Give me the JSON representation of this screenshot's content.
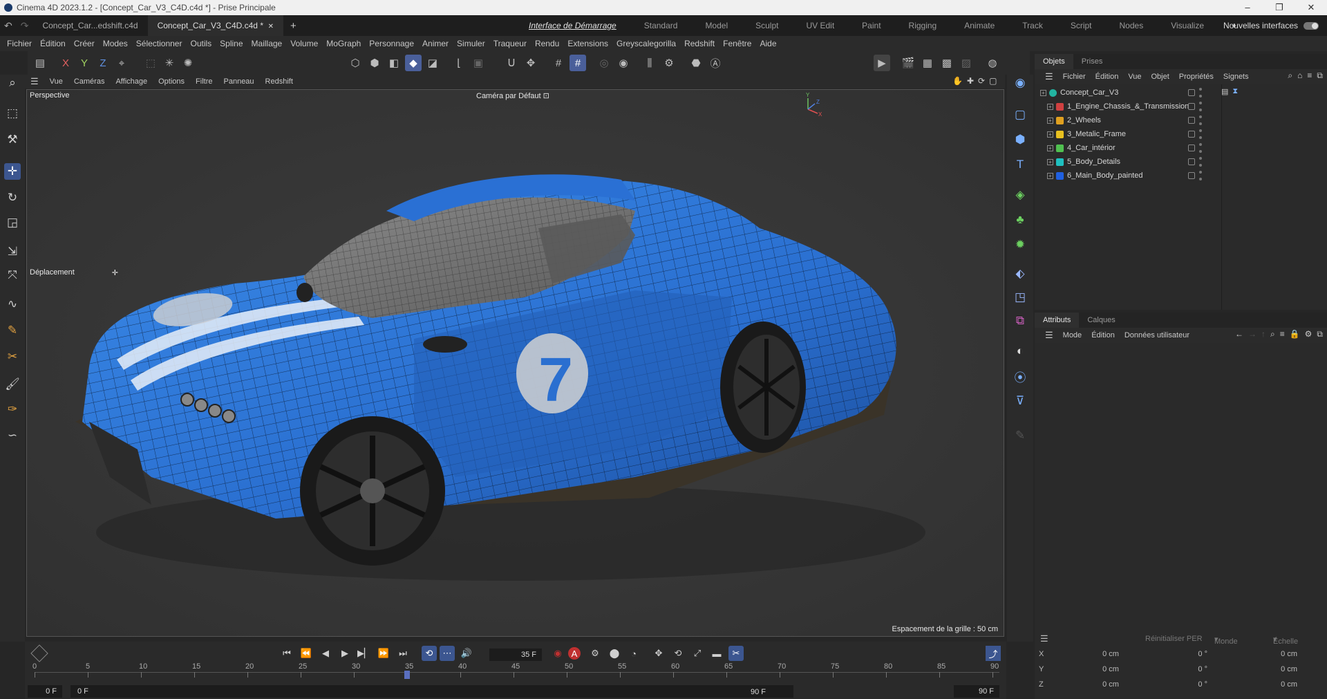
{
  "window": {
    "title": "Cinema 4D 2023.1.2 - [Concept_Car_V3_C4D.c4d *] - Prise Principale",
    "minimize": "–",
    "maximize": "❐",
    "close": "✕"
  },
  "tabs": {
    "doc1": "Concept_Car...edshift.c4d",
    "doc2": "Concept_Car_V3_C4D.c4d *",
    "close": "✕",
    "add": "+"
  },
  "layouts": [
    "Interface de Démarrage",
    "Standard",
    "Model",
    "Sculpt",
    "UV Edit",
    "Paint",
    "Rigging",
    "Animate",
    "Track",
    "Script",
    "Nodes",
    "Visualize"
  ],
  "layout_add": "+",
  "new_interfaces": "Nouvelles interfaces",
  "menu": [
    "Fichier",
    "Édition",
    "Créer",
    "Modes",
    "Sélectionner",
    "Outils",
    "Spline",
    "Maillage",
    "Volume",
    "MoGraph",
    "Personnage",
    "Animer",
    "Simuler",
    "Traqueur",
    "Rendu",
    "Extensions",
    "Greyscalegorilla",
    "Redshift",
    "Fenêtre",
    "Aide"
  ],
  "axis_toggles": {
    "x": "X",
    "y": "Y",
    "z": "Z"
  },
  "viewport": {
    "menu": [
      "Vue",
      "Caméras",
      "Affichage",
      "Options",
      "Filtre",
      "Panneau",
      "Redshift"
    ],
    "view_name": "Perspective",
    "camera": "Caméra par Défaut",
    "hud_tool": "Déplacement",
    "grid_spacing": "Espacement de la grille : 50 cm",
    "car_number": "7"
  },
  "objects": {
    "tabs": [
      "Objets",
      "Prises"
    ],
    "menu": [
      "Fichier",
      "Édition",
      "Vue",
      "Objet",
      "Propriétés",
      "Signets"
    ],
    "items": [
      {
        "name": "Concept_Car_V3",
        "color": "#22b3a0"
      },
      {
        "name": "1_Engine_Chassis_&_Transmission",
        "color": "#d04040"
      },
      {
        "name": "2_Wheels",
        "color": "#e0a020"
      },
      {
        "name": "3_Metalic_Frame",
        "color": "#e8c020"
      },
      {
        "name": "4_Car_intérior",
        "color": "#50c050"
      },
      {
        "name": "5_Body_Details",
        "color": "#20c0c0"
      },
      {
        "name": "6_Main_Body_painted",
        "color": "#2060e0"
      }
    ]
  },
  "attributes": {
    "tabs": [
      "Attributs",
      "Calques"
    ],
    "menu": [
      "Mode",
      "Édition",
      "Données utilisateur"
    ]
  },
  "coords": {
    "reset": "Réinitialiser PER",
    "space": "Monde",
    "scale": "Échelle",
    "rows": [
      {
        "axis": "X",
        "pos": "0 cm",
        "rot": "0 °",
        "size": "0 cm"
      },
      {
        "axis": "Y",
        "pos": "0 cm",
        "rot": "0 °",
        "size": "0 cm"
      },
      {
        "axis": "Z",
        "pos": "0 cm",
        "rot": "0 °",
        "size": "0 cm"
      }
    ]
  },
  "timeline": {
    "current_frame": "35 F",
    "ticks": [
      "0",
      "5",
      "10",
      "15",
      "20",
      "25",
      "30",
      "35",
      "40",
      "45",
      "50",
      "55",
      "60",
      "65",
      "70",
      "75",
      "80",
      "85",
      "90"
    ],
    "start": "0 F",
    "start2": "0 F",
    "end": "90 F",
    "end2": "90 F",
    "playhead_frame": 35,
    "total_frames": 90
  },
  "colors": {
    "accent": "#3c5690",
    "car_body": "#2a6fd0"
  }
}
